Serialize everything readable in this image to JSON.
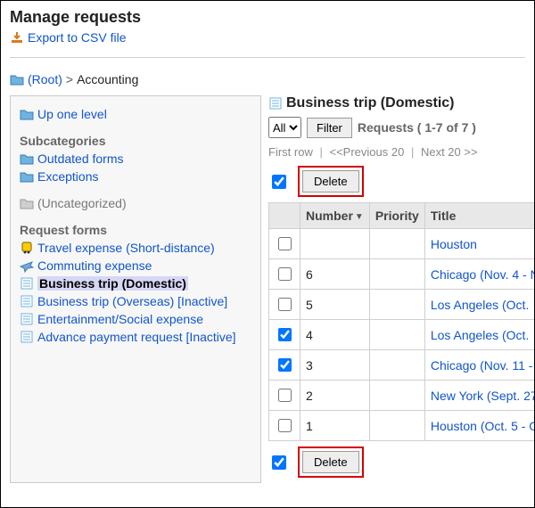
{
  "header": {
    "title": "Manage requests",
    "export_label": "Export to CSV file"
  },
  "breadcrumb": {
    "root_label": "(Root)",
    "sep": ">",
    "current": "Accounting"
  },
  "left": {
    "up_label": "Up one level",
    "subcat_head": "Subcategories",
    "subcats": [
      {
        "label": "Outdated forms"
      },
      {
        "label": "Exceptions"
      }
    ],
    "uncat_label": "(Uncategorized)",
    "forms_head": "Request forms",
    "forms": [
      {
        "label": "Travel expense (Short-distance)",
        "icon": "train"
      },
      {
        "label": "Commuting expense",
        "icon": "plane"
      },
      {
        "label": "Business trip (Domestic)",
        "icon": "form",
        "selected": true
      },
      {
        "label": "Business trip (Overseas) [Inactive]",
        "icon": "form"
      },
      {
        "label": "Entertainment/Social expense",
        "icon": "form"
      },
      {
        "label": "Advance payment request [Inactive]",
        "icon": "form"
      }
    ]
  },
  "right": {
    "title": "Business trip (Domestic)",
    "filter": {
      "selected": "All",
      "button": "Filter",
      "count_label": "Requests ( 1-7 of 7 )"
    },
    "pager": {
      "first": "First row",
      "prev": "<<Previous 20",
      "next": "Next 20 >>"
    },
    "delete_label": "Delete",
    "columns": {
      "number": "Number",
      "priority": "Priority",
      "title": "Title"
    },
    "rows": [
      {
        "checked": false,
        "number": "",
        "priority": "",
        "title": "Houston"
      },
      {
        "checked": false,
        "number": "6",
        "priority": "",
        "title": "Chicago (Nov. 4 - N"
      },
      {
        "checked": false,
        "number": "5",
        "priority": "",
        "title": "Los Angeles (Oct. "
      },
      {
        "checked": true,
        "number": "4",
        "priority": "",
        "title": "Los Angeles (Oct. "
      },
      {
        "checked": true,
        "number": "3",
        "priority": "",
        "title": "Chicago (Nov. 11 - "
      },
      {
        "checked": false,
        "number": "2",
        "priority": "",
        "title": "New York (Sept. 27"
      },
      {
        "checked": false,
        "number": "1",
        "priority": "",
        "title": "Houston (Oct. 5 - O"
      }
    ],
    "top_check": true,
    "bottom_check": true
  }
}
